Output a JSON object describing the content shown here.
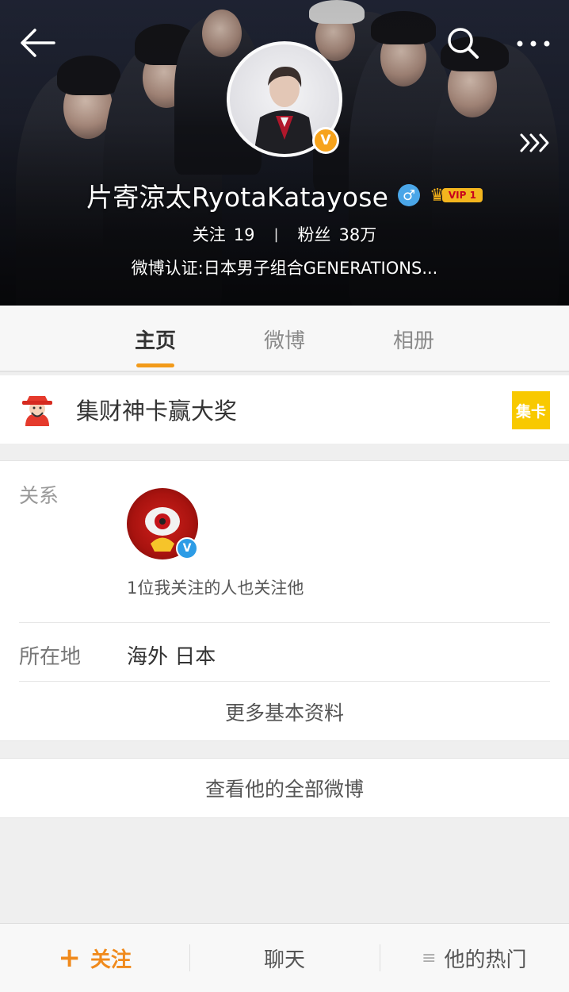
{
  "profile": {
    "name": "片寄涼太RyotaKatayose",
    "verify_badge_glyph": "V",
    "gender_glyph": "♂",
    "vip_label": "VIP 1",
    "following_label": "关注",
    "following_count": "19",
    "stats_separator": "|",
    "followers_label": "粉丝",
    "followers_count": "38万",
    "verification": "微博认证:日本男子组合GENERATIONS..."
  },
  "tabs": [
    {
      "label": "主页",
      "active": true
    },
    {
      "label": "微博",
      "active": false
    },
    {
      "label": "相册",
      "active": false
    }
  ],
  "promo": {
    "text": "集财神卡赢大奖",
    "tag": "集卡"
  },
  "info": {
    "relation_label": "关系",
    "mutual_badge_glyph": "V",
    "mutual_text": "1位我关注的人也关注他",
    "location_label": "所在地",
    "location_value": "海外 日本",
    "more_info": "更多基本资料"
  },
  "view_all": "查看他的全部微博",
  "bottom_bar": {
    "follow_plus": "+",
    "follow": "关注",
    "chat": "聊天",
    "hot_icon": "≡",
    "hot": "他的热门"
  },
  "icons": {
    "back": "back-arrow-icon",
    "search": "search-icon",
    "more": "more-dots-icon",
    "expand": "triple-chevron-icon"
  },
  "colors": {
    "accent": "#f29a1a",
    "verify_orange": "#f7a31c",
    "verify_blue": "#2d9ce6",
    "promo_tag": "#f8c900"
  }
}
